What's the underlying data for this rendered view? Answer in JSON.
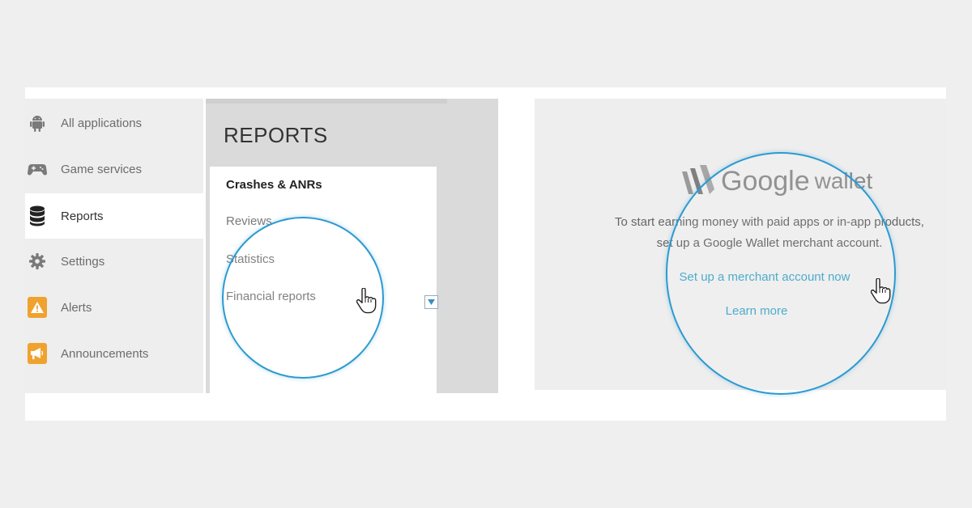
{
  "sidebar": {
    "items": [
      {
        "label": "All applications",
        "icon": "android-icon"
      },
      {
        "label": "Game services",
        "icon": "gamepad-icon"
      },
      {
        "label": "Reports",
        "icon": "database-icon",
        "active": true
      },
      {
        "label": "Settings",
        "icon": "gear-icon"
      },
      {
        "label": "Alerts",
        "icon": "warning-icon"
      },
      {
        "label": "Announcements",
        "icon": "megaphone-icon"
      }
    ]
  },
  "reports": {
    "title": "REPORTS",
    "items": [
      {
        "label": "Crashes & ANRs"
      },
      {
        "label": "Reviews"
      },
      {
        "label": "Statistics"
      },
      {
        "label": "Financial reports"
      }
    ]
  },
  "wallet": {
    "logo_google": "Google",
    "logo_wallet": "wallet",
    "line1": "To start earning money with paid apps or in-app products,",
    "line2": "set up a Google Wallet merchant account.",
    "setup_link": "Set up a merchant account now",
    "learn_more": "Learn more"
  },
  "colors": {
    "accent_link": "#43a7c9",
    "magnifier_ring": "#2c9ad0",
    "alert_badge": "#f0a22e"
  }
}
